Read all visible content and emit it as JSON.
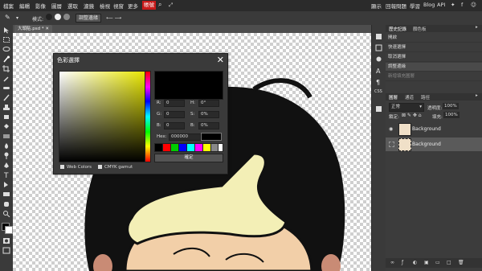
{
  "menubar": {
    "items": [
      "檔案",
      "編輯",
      "影像",
      "圖層",
      "選取",
      "濾鏡",
      "檢視",
      "視窗",
      "更多"
    ],
    "highlight": "帳號",
    "right_items": [
      "顯示",
      "回報問題",
      "學習",
      "Blog",
      "API"
    ]
  },
  "options_bar": {
    "mode_label": "模式:",
    "select_label": "調整邊緣"
  },
  "document": {
    "tab_label": "大頭貼.psd *"
  },
  "history_panel": {
    "tabs": [
      "歷史記錄",
      "顏色板"
    ],
    "items": [
      "開啟",
      "快速選擇",
      "取消選擇",
      "調整邊緣",
      "新增填充圖層"
    ]
  },
  "layers_panel": {
    "tabs": [
      "圖層",
      "通道",
      "路徑"
    ],
    "blend_mode": "正常",
    "opacity_label": "透明度:",
    "opacity_value": "100%",
    "lock_label": "鎖定:",
    "fill_label": "填充:",
    "fill_value": "100%",
    "layers": [
      {
        "name": "Background"
      },
      {
        "name": "Background"
      }
    ]
  },
  "color_dialog": {
    "title": "色彩選擇",
    "fields": {
      "r_label": "R:",
      "r_value": "0",
      "g_label": "G:",
      "g_value": "0",
      "b_label": "B:",
      "b_value": "0",
      "h_label": "H:",
      "h_value": "0°",
      "s_label": "S:",
      "s_value": "0%",
      "v_label": "B:",
      "v_value": "0%",
      "hex_label": "Hex:",
      "hex_value": "000000"
    },
    "swatches": [
      "#000000",
      "#ff0000",
      "#00cc00",
      "#0000ff",
      "#00ffff",
      "#ff00ff",
      "#ffff00",
      "#888888",
      "#ffffff"
    ],
    "ok_label": "確定",
    "web_colors_label": "Web Colors",
    "cmyk_label": "CMYK gamut"
  },
  "midtools": {
    "label_css": "CSS"
  },
  "colors": {
    "accent": "#c81a1a",
    "panel": "#3c3c3c",
    "hair": "#111111",
    "skin": "#f2cfa8",
    "hat": "#f3efb6"
  }
}
